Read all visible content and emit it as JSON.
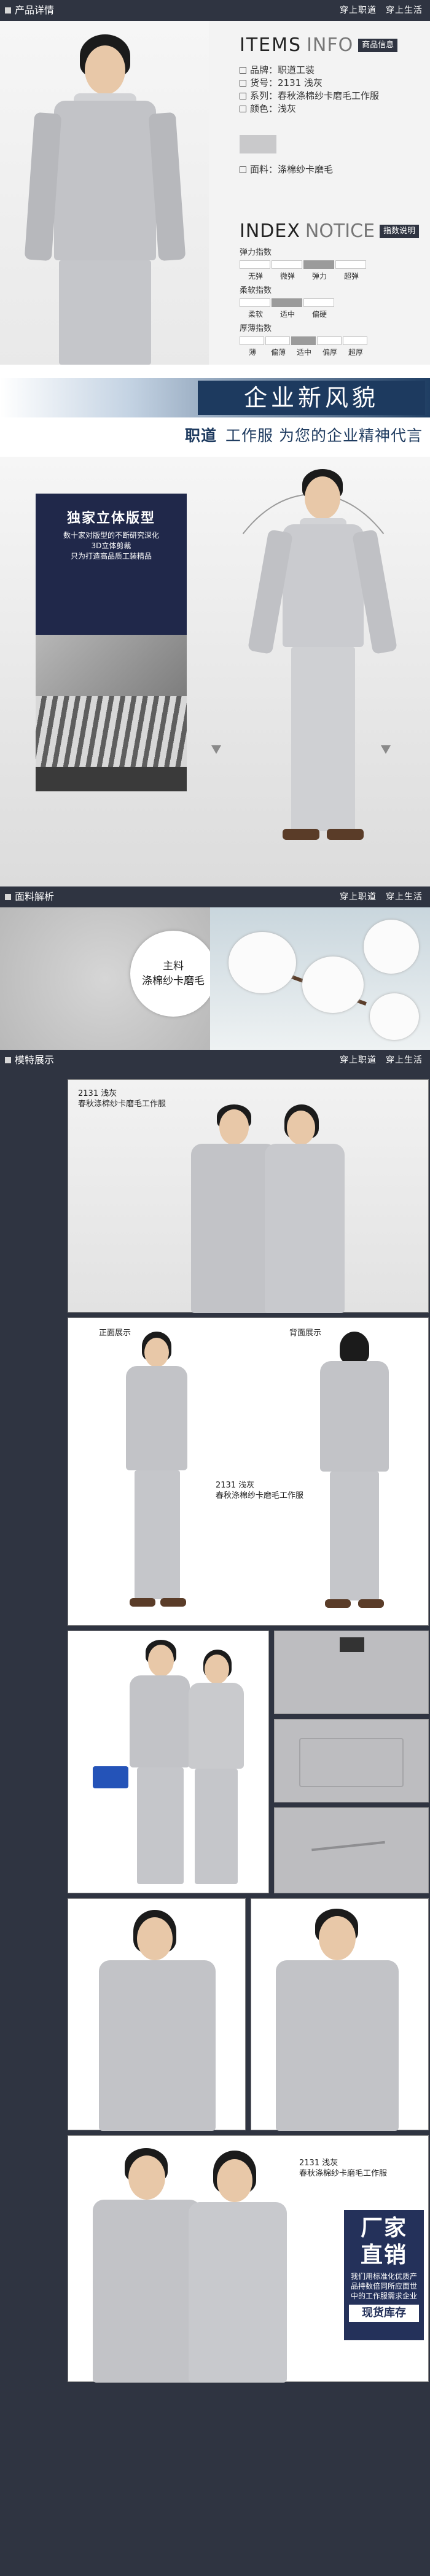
{
  "sections": {
    "details": "产品详情",
    "fabric": "面料解析",
    "models": "模特展示"
  },
  "slogan": "穿上职道　穿上生活",
  "items": {
    "title_a": "ITEMS",
    "title_b": "INFO",
    "tag": "商品信息",
    "rows": [
      "品牌：职道工装",
      "货号：2131 浅灰",
      "系列：春秋涤棉纱卡磨毛工作服",
      "颜色：浅灰"
    ],
    "swatch_color": "#c9c9cb",
    "fabric": "面料：涤棉纱卡磨毛"
  },
  "index": {
    "title_a": "INDEX",
    "title_b": "NOTICE",
    "tag": "指数说明",
    "scales": [
      {
        "name": "弹力指数",
        "labels": [
          "无弹",
          "微弹",
          "弹力",
          "超弹"
        ],
        "level": 2
      },
      {
        "name": "柔软指数",
        "labels": [
          "柔软",
          "适中",
          "偏硬"
        ],
        "level": 2
      },
      {
        "name": "厚薄指数",
        "labels": [
          "薄",
          "偏薄",
          "适中",
          "偏厚",
          "超厚"
        ],
        "level": 3
      }
    ]
  },
  "banner": {
    "headline": "企业新风貌",
    "brand": "职道",
    "tagline": "工作服 为您的企业精神代言"
  },
  "design": {
    "title": "独家立体版型",
    "lines": [
      "数十家对版型的不断研究深化",
      "3D立体剪裁",
      "只为打造高品质工装精品"
    ]
  },
  "fabric_section": {
    "line1": "主料",
    "line2": "涤棉纱卡磨毛"
  },
  "captions": {
    "cap1": "2131 浅灰\n春秋涤棉纱卡磨毛工作服",
    "front": "正面展示",
    "back": "背面展示",
    "cap2": "2131 浅灰\n春秋涤棉纱卡磨毛工作服",
    "cap3": "2131 浅灰\n春秋涤棉纱卡磨毛工作服"
  },
  "sale": {
    "line1": "厂家",
    "line2": "直销",
    "text": "我们用标准化优质产品持数倍同所应面世中的工作服需求企业",
    "stock": "现货库存"
  }
}
